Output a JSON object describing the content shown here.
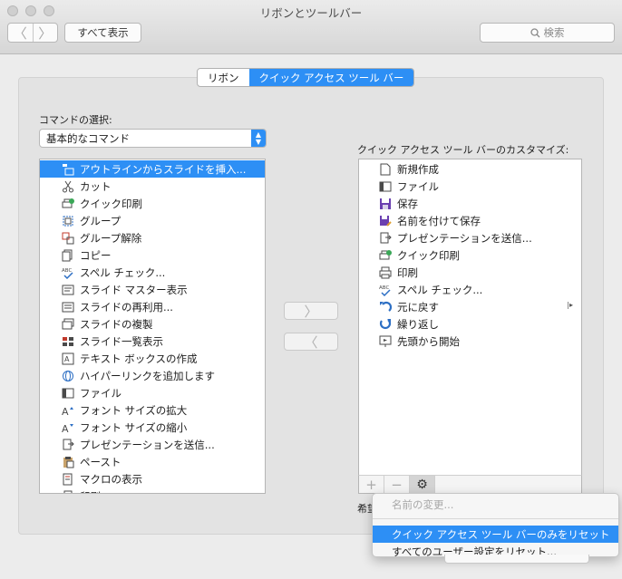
{
  "window": {
    "title": "リボンとツールバー"
  },
  "toolbar": {
    "back_label": "〈",
    "forward_label": "〉",
    "show_all_label": "すべて表示",
    "search_placeholder": "検索"
  },
  "tabs": [
    {
      "label": "リボン",
      "active": false
    },
    {
      "label": "クイック アクセス ツール バー",
      "active": true
    }
  ],
  "commands": {
    "label": "コマンドの選択:",
    "selected_category": "基本的なコマンド",
    "items": [
      {
        "label": "アウトラインからスライドを挿入...",
        "icon": "outline-slides-icon",
        "selected": true
      },
      {
        "label": "カット",
        "icon": "scissors-icon"
      },
      {
        "label": "クイック印刷",
        "icon": "quick-print-icon"
      },
      {
        "label": "グループ",
        "icon": "group-icon"
      },
      {
        "label": "グループ解除",
        "icon": "ungroup-icon"
      },
      {
        "label": "コピー",
        "icon": "copy-icon"
      },
      {
        "label": "スペル チェック...",
        "icon": "spellcheck-icon"
      },
      {
        "label": "スライド マスター表示",
        "icon": "slide-master-icon"
      },
      {
        "label": "スライドの再利用...",
        "icon": "reuse-slides-icon"
      },
      {
        "label": "スライドの複製",
        "icon": "duplicate-slide-icon"
      },
      {
        "label": "スライド一覧表示",
        "icon": "slide-sorter-icon"
      },
      {
        "label": "テキスト ボックスの作成",
        "icon": "text-box-icon"
      },
      {
        "label": "ハイパーリンクを追加します",
        "icon": "hyperlink-icon"
      },
      {
        "label": "ファイル",
        "icon": "file-icon"
      },
      {
        "label": "フォント サイズの拡大",
        "icon": "font-grow-icon"
      },
      {
        "label": "フォント サイズの縮小",
        "icon": "font-shrink-icon"
      },
      {
        "label": "プレゼンテーションを送信...",
        "icon": "send-presentation-icon"
      },
      {
        "label": "ペースト",
        "icon": "paste-icon"
      },
      {
        "label": "マクロの表示",
        "icon": "macro-icon"
      },
      {
        "label": "印刷",
        "icon": "print-icon"
      }
    ]
  },
  "qat": {
    "label": "クイック アクセス ツール バーのカスタマイズ:",
    "items": [
      {
        "label": "新規作成",
        "icon": "new-document-icon"
      },
      {
        "label": "ファイル",
        "icon": "file-icon"
      },
      {
        "label": "保存",
        "icon": "save-icon"
      },
      {
        "label": "名前を付けて保存",
        "icon": "save-as-icon"
      },
      {
        "label": "プレゼンテーションを送信...",
        "icon": "send-presentation-icon"
      },
      {
        "label": "クイック印刷",
        "icon": "quick-print-icon"
      },
      {
        "label": "印刷",
        "icon": "print-icon"
      },
      {
        "label": "スペル チェック...",
        "icon": "spellcheck-icon"
      },
      {
        "label": "元に戻す",
        "icon": "undo-icon"
      },
      {
        "label": "繰り返し",
        "icon": "redo-icon"
      },
      {
        "label": "先頭から開始",
        "icon": "start-slideshow-icon"
      }
    ],
    "add_label": "+",
    "remove_label": "−",
    "gear_label": "⚙",
    "hint_text": "希望"
  },
  "transfer": {
    "add_label": "〉",
    "remove_label": "〈"
  },
  "context_menu": {
    "items": [
      {
        "label": "名前の変更...",
        "disabled": true
      },
      {
        "label": "クイック アクセス ツール バーのみをリセット",
        "highlighted": true
      },
      {
        "label": "すべてのユーザー設定をリセット..."
      }
    ]
  },
  "colors": {
    "accent": "#2d8ff5",
    "background": "#ececec"
  }
}
